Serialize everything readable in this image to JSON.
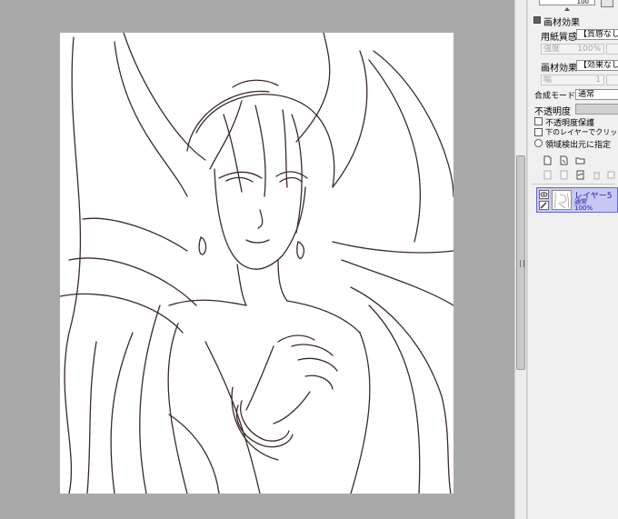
{
  "panel": {
    "top_field_text": "100",
    "texture_section_title": "画材効果",
    "paper_texture_label": "用紙質感",
    "paper_texture_value": "【質感なし】",
    "paper_strength_left": "強度",
    "paper_strength_right": "100%",
    "brush_effect_label": "画材効果",
    "brush_effect_value": "【効果なし】",
    "brush_effect_left": "幅",
    "brush_effect_right": "1",
    "blend_mode_label": "合成モード",
    "blend_mode_value": "通常",
    "opacity_label": "不透明度",
    "protect_opacity_label": "不透明度保護",
    "clip_layer_label": "下のレイヤーでクリッピング",
    "selection_source_label": "領域検出元に指定"
  },
  "layer": {
    "name": "レイヤー5",
    "mode": "通常",
    "opacity": "100%"
  },
  "colors": {
    "canvas_bg": "#a9a9a9",
    "panel_bg": "#f0f0f0",
    "layer_selected_bg": "#c8c8f5",
    "lineart": "#3a2a28"
  },
  "icons": [
    "eye-icon",
    "pen-icon",
    "new-layer-icon",
    "new-file-layer-icon",
    "folder-icon",
    "delete-icon"
  ]
}
